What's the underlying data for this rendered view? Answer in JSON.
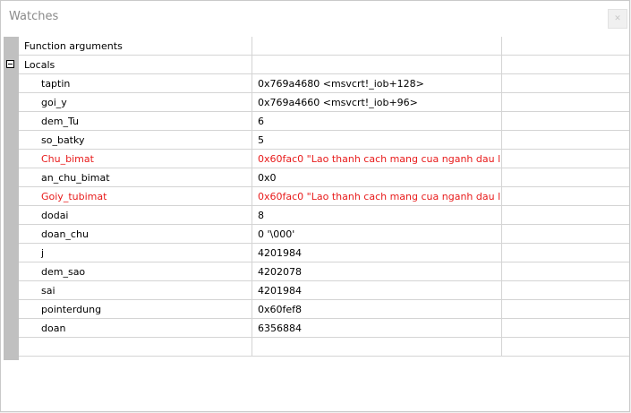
{
  "window": {
    "title": "Watches",
    "close_glyph": "✕"
  },
  "rows": [
    {
      "name": "Function arguments",
      "value": "",
      "color": "normal"
    },
    {
      "name": "Locals",
      "value": "",
      "color": "normal",
      "expanded": true
    },
    {
      "name": "taptin",
      "value": "0x769a4680 <msvcrt!_iob+128>",
      "color": "normal"
    },
    {
      "name": "goi_y",
      "value": "0x769a4660 <msvcrt!_iob+96>",
      "color": "normal"
    },
    {
      "name": "dem_Tu",
      "value": "6",
      "color": "normal"
    },
    {
      "name": "so_batky",
      "value": "5",
      "color": "normal"
    },
    {
      "name": "Chu_bimat",
      "value": "0x60fac0 \"Lao thanh cach mang cua nganh dau l",
      "color": "changed"
    },
    {
      "name": "an_chu_bimat",
      "value": "0x0",
      "color": "normal"
    },
    {
      "name": "Goiy_tubimat",
      "value": "0x60fac0 \"Lao thanh cach mang cua nganh dau l",
      "color": "changed"
    },
    {
      "name": "dodai",
      "value": "8",
      "color": "normal"
    },
    {
      "name": "doan_chu",
      "value": "0 '\\000'",
      "color": "normal"
    },
    {
      "name": "j",
      "value": "4201984",
      "color": "normal"
    },
    {
      "name": "dem_sao",
      "value": "4202078",
      "color": "normal"
    },
    {
      "name": "sai",
      "value": "4201984",
      "color": "normal"
    },
    {
      "name": "pointerdung",
      "value": "0x60fef8",
      "color": "normal"
    },
    {
      "name": "doan",
      "value": "6356884",
      "color": "normal"
    },
    {
      "name": "",
      "value": "",
      "color": "normal"
    }
  ],
  "colors": {
    "changed": "#e81b1b",
    "normal": "#000000",
    "gutter": "#c0c0c0"
  },
  "icons": {
    "close": "close-icon",
    "collapse": "collapse-icon"
  }
}
